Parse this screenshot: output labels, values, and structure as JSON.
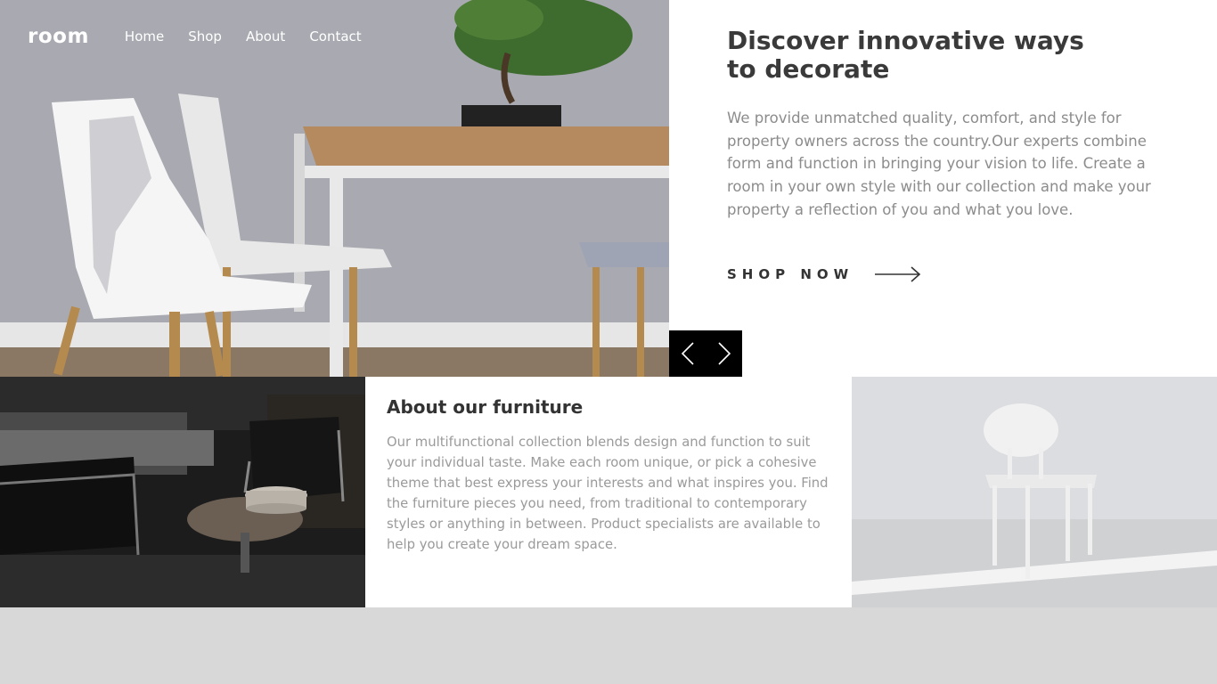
{
  "nav": {
    "logo": "room",
    "links": [
      "Home",
      "Shop",
      "About",
      "Contact"
    ]
  },
  "hero": {
    "title": "Discover innovative ways to decorate",
    "description": "We provide unmatched quality, comfort, and style for property owners across the country.Our experts combine form and function in bringing your vision to life. Create a room in your own style with our collection and make your property a reflection of you and what you love.",
    "cta_label": "SHOP NOW",
    "cta_icon": "arrow-right-icon"
  },
  "slider": {
    "prev_icon": "chevron-left-icon",
    "next_icon": "chevron-right-icon"
  },
  "about": {
    "title": "About our furniture",
    "description": "Our multifunctional collection blends design and function to suit your individual taste. Make each room unique, or pick a cohesive theme that best express your interests and what inspires you. Find the furniture pieces you need, from traditional to contemporary styles or anything in between. Product specialists are available to help you create your dream space."
  },
  "colors": {
    "heading": "#3a3a3a",
    "body_text": "#8c8c8c",
    "slider_bg": "#000000",
    "page_bg": "#d8d8d8"
  }
}
